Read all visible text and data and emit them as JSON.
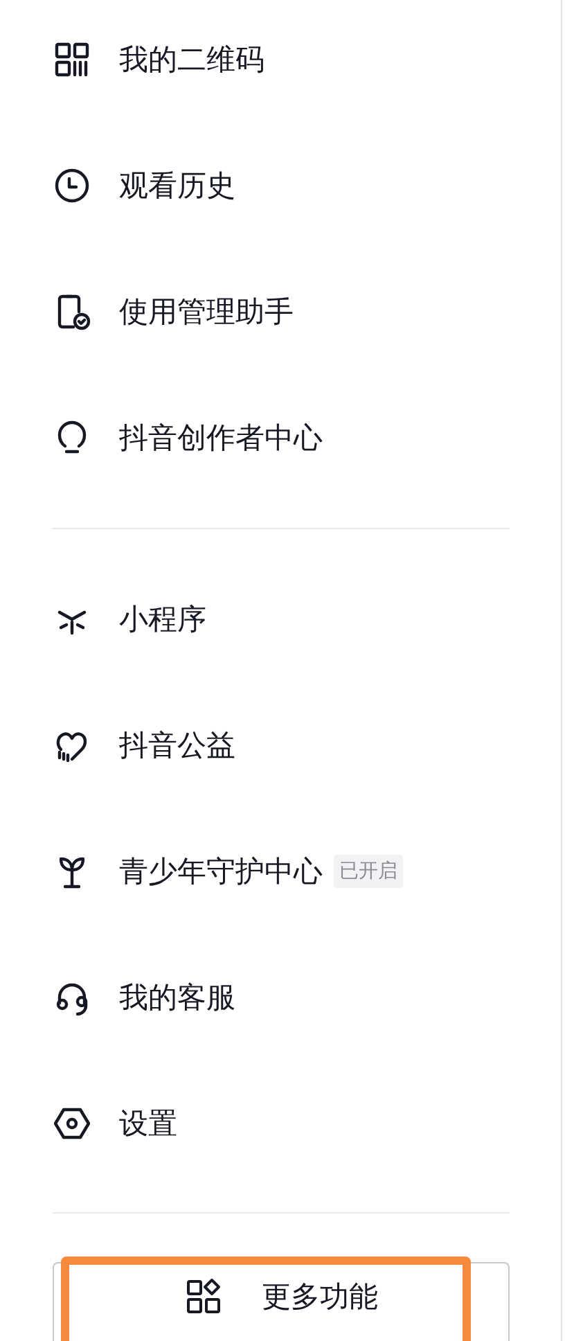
{
  "menu_groups": [
    {
      "items": [
        {
          "label": "我的二维码"
        },
        {
          "label": "观看历史"
        },
        {
          "label": "使用管理助手"
        },
        {
          "label": "抖音创作者中心"
        }
      ]
    },
    {
      "items": [
        {
          "label": "小程序"
        },
        {
          "label": "抖音公益"
        },
        {
          "label": "青少年守护中心",
          "badge": "已开启"
        },
        {
          "label": "我的客服"
        },
        {
          "label": "设置"
        }
      ]
    }
  ],
  "more_button": {
    "label": "更多功能",
    "highlighted": true
  }
}
